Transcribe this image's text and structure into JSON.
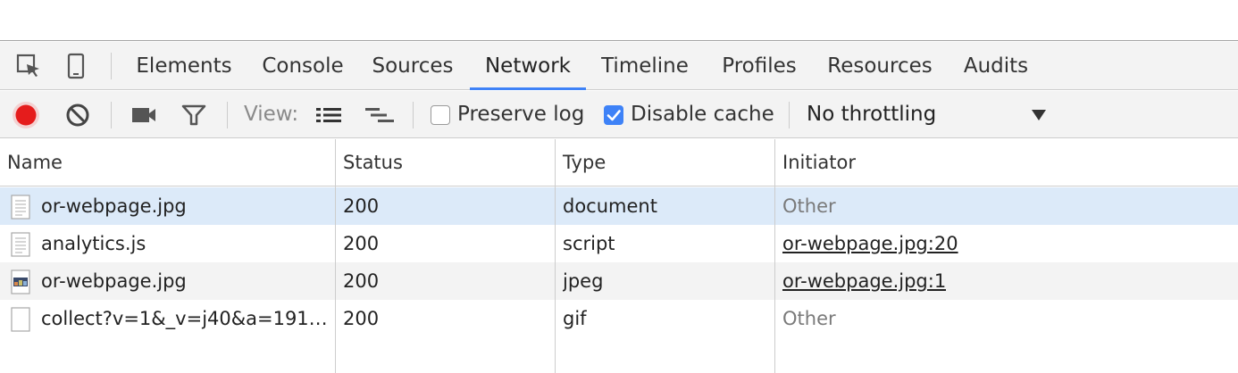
{
  "tabs": [
    {
      "label": "Elements",
      "active": false
    },
    {
      "label": "Console",
      "active": false
    },
    {
      "label": "Sources",
      "active": false
    },
    {
      "label": "Network",
      "active": true
    },
    {
      "label": "Timeline",
      "active": false
    },
    {
      "label": "Profiles",
      "active": false
    },
    {
      "label": "Resources",
      "active": false
    },
    {
      "label": "Audits",
      "active": false
    }
  ],
  "toolbar": {
    "view_label": "View:",
    "preserve_log_label": "Preserve log",
    "preserve_log_checked": false,
    "disable_cache_label": "Disable cache",
    "disable_cache_checked": true,
    "throttling_value": "No throttling",
    "record_color": "#e51c1c",
    "accent_color": "#3e82f7"
  },
  "table": {
    "columns": [
      "Name",
      "Status",
      "Type",
      "Initiator"
    ],
    "rows": [
      {
        "name": "or-webpage.jpg",
        "status": "200",
        "type": "document",
        "initiator": "Other",
        "initiator_link": false,
        "icon": "document-icon",
        "selected": true
      },
      {
        "name": "analytics.js",
        "status": "200",
        "type": "script",
        "initiator": "or-webpage.jpg:20",
        "initiator_link": true,
        "icon": "script-icon",
        "selected": false
      },
      {
        "name": "or-webpage.jpg",
        "status": "200",
        "type": "jpeg",
        "initiator": "or-webpage.jpg:1",
        "initiator_link": true,
        "icon": "image-thumbnail-icon",
        "selected": false
      },
      {
        "name": "collect?v=1&_v=j40&a=191…",
        "status": "200",
        "type": "gif",
        "initiator": "Other",
        "initiator_link": false,
        "icon": "blank-file-icon",
        "selected": false
      }
    ]
  }
}
